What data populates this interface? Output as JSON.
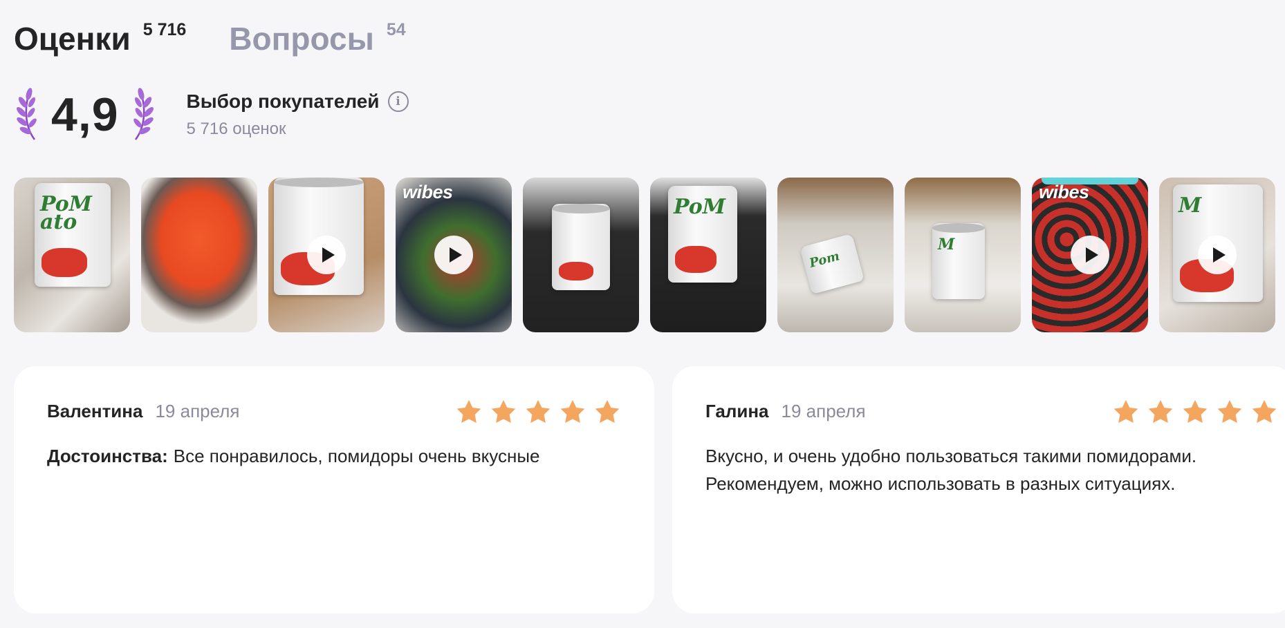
{
  "tabs": [
    {
      "label": "Оценки",
      "count": "5 716",
      "active": true
    },
    {
      "label": "Вопросы",
      "count": "54",
      "active": false
    }
  ],
  "rating": {
    "score": "4,9",
    "badge": "Выбор покупателей",
    "count_text": "5 716 оценок",
    "laurel_color": "#9b59d0"
  },
  "gallery": {
    "items": [
      {
        "kind": "photo",
        "video": false,
        "wibes": false
      },
      {
        "kind": "photo",
        "video": false,
        "wibes": false
      },
      {
        "kind": "video",
        "video": true,
        "wibes": false
      },
      {
        "kind": "video",
        "video": true,
        "wibes": true
      },
      {
        "kind": "photo",
        "video": false,
        "wibes": false
      },
      {
        "kind": "photo",
        "video": false,
        "wibes": false
      },
      {
        "kind": "photo",
        "video": false,
        "wibes": false
      },
      {
        "kind": "photo",
        "video": false,
        "wibes": false
      },
      {
        "kind": "video",
        "video": true,
        "wibes": true
      },
      {
        "kind": "video",
        "video": true,
        "wibes": false
      }
    ],
    "wibes_label": "wibes",
    "can_logo": "PoM ato"
  },
  "reviews": [
    {
      "author": "Валентина",
      "date": "19 апреля",
      "stars": 5,
      "label": "Достоинства:",
      "text": "Все понравилось, помидоры очень вкусные"
    },
    {
      "author": "Галина",
      "date": "19 апреля",
      "stars": 5,
      "label": "",
      "text": "Вкусно, и очень удобно пользоваться такими помидорами. Рекомендуем, можно использовать в разных ситуациях."
    }
  ],
  "colors": {
    "star": "#f4a65f",
    "muted": "#8a8a9c",
    "text": "#242424"
  }
}
